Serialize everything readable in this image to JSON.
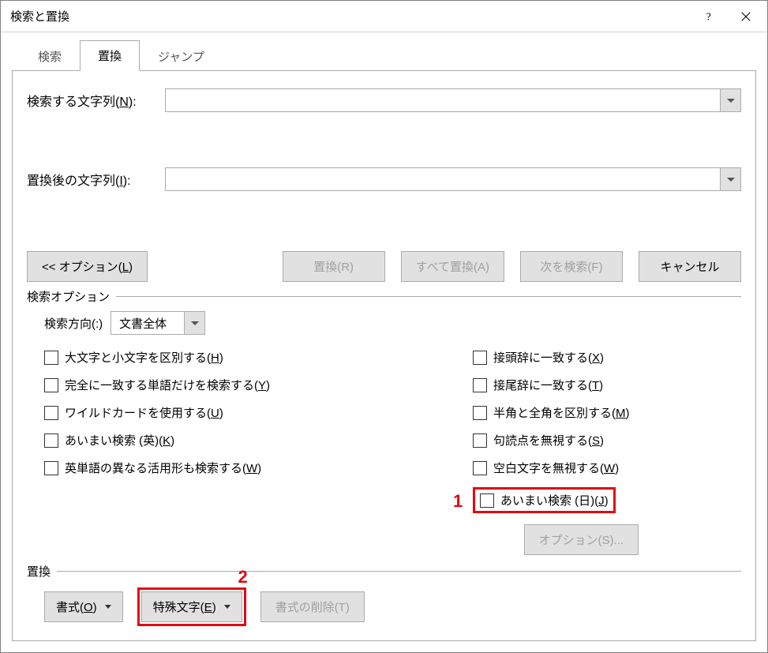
{
  "title": "検索と置換",
  "tabs": {
    "search": "検索",
    "replace": "置換",
    "jump": "ジャンプ"
  },
  "fields": {
    "find_label_pre": "検索する文字列(",
    "find_label_key": "N",
    "find_label_post": "):",
    "replace_label_pre": "置換後の文字列(",
    "replace_label_key": "I",
    "replace_label_post": "):",
    "find_value": "",
    "replace_value": ""
  },
  "buttons": {
    "options_pre": "<< オプション(",
    "options_key": "L",
    "options_post": ")",
    "replace": "置換(R)",
    "replace_all": "すべて置換(A)",
    "find_next": "次を検索(F)",
    "cancel": "キャンセル"
  },
  "search_options": {
    "legend": "検索オプション",
    "direction_label": "検索方向(:)",
    "direction_value": "文書全体",
    "left": [
      {
        "pre": "大文字と小文字を区別する(",
        "key": "H",
        "post": ")"
      },
      {
        "pre": "完全に一致する単語だけを検索する(",
        "key": "Y",
        "post": ")"
      },
      {
        "pre": "ワイルドカードを使用する(",
        "key": "U",
        "post": ")"
      },
      {
        "pre": "あいまい検索 (英)(",
        "key": "K",
        "post": ")"
      },
      {
        "pre": "英単語の異なる活用形も検索する(",
        "key": "W",
        "post": ")"
      }
    ],
    "right": [
      {
        "pre": "接頭辞に一致する(",
        "key": "X",
        "post": ")"
      },
      {
        "pre": "接尾辞に一致する(",
        "key": "T",
        "post": ")"
      },
      {
        "pre": "半角と全角を区別する(",
        "key": "M",
        "post": ")"
      },
      {
        "pre": "句読点を無視する(",
        "key": "S",
        "post": ")"
      },
      {
        "pre": "空白文字を無視する(",
        "key": "W",
        "post": ")"
      },
      {
        "pre": "あいまい検索 (日)(",
        "key": "J",
        "post": ")"
      }
    ],
    "sub_options_btn": "オプション(S)..."
  },
  "replace_section": {
    "legend": "置換",
    "format_pre": "書式(",
    "format_key": "O",
    "format_post": ")",
    "special_pre": "特殊文字(",
    "special_key": "E",
    "special_post": ")",
    "clear_format": "書式の削除(T)"
  },
  "callouts": {
    "one": "1",
    "two": "2"
  }
}
